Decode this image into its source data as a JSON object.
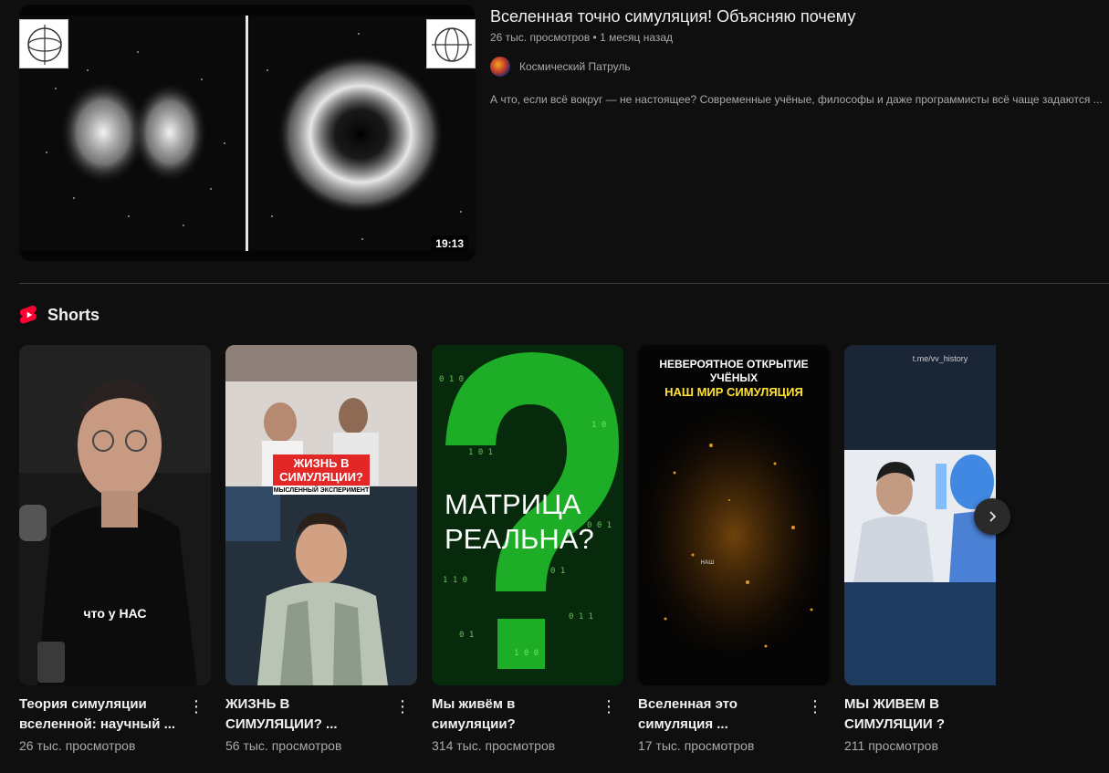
{
  "video": {
    "title": "Вселенная точно симуляция! Объясняю почему",
    "stats": "26 тыс. просмотров • 1 месяц назад",
    "channel": "Космический Патруль",
    "description": "А что, если всё вокруг — не настоящее? Современные учёные, философы и даже программисты всё чаще задаются ...",
    "duration": "19:13"
  },
  "shorts": {
    "heading": "Shorts",
    "items": [
      {
        "title": "Теория симуляции вселенной: научный ...",
        "views": "26 тыс. просмотров",
        "overlay": "что у НАС"
      },
      {
        "title": "ЖИЗНЬ В СИМУЛЯЦИИ? ...",
        "views": "56 тыс. просмотров",
        "overlay": "ЖИЗНЬ В СИМУЛЯЦИИ?",
        "overlay_sub": "МЫСЛЕННЫЙ ЭКСПЕРИМЕНТ"
      },
      {
        "title": "Мы живём в симуляции?",
        "views": "314 тыс. просмотров",
        "overlay": "МАТРИЦА РЕАЛЬНА?"
      },
      {
        "title": "Вселенная это симуляция ...",
        "views": "17 тыс. просмотров",
        "overlay": "НЕВЕРОЯТНОЕ ОТКРЫТИЕ УЧЁНЫХ",
        "overlay_sub": "НАШ МИР СИМУЛЯЦИЯ",
        "overlay_small": "НАШ"
      },
      {
        "title": "МЫ ЖИВЕМ В СИМУЛЯЦИИ ?",
        "views": "211 просмотров",
        "overlay": "t.me/vv_history"
      }
    ]
  },
  "colors": {
    "accent": "#ff0033",
    "green_text": "#39ff14"
  },
  "icons": {
    "shorts": "shorts-icon",
    "next": "chevron-right-icon",
    "menu": "more-vert-icon"
  }
}
